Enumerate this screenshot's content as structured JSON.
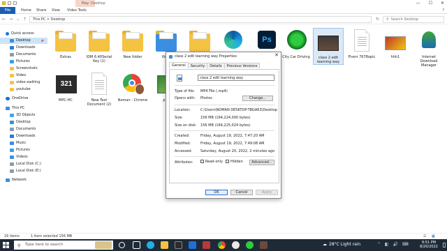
{
  "window": {
    "title": "Desktop",
    "context_tab": "Play",
    "controls": {
      "minimize": "—",
      "maximize": "☐",
      "close": "✕"
    }
  },
  "ribbon": {
    "tabs": [
      "File",
      "Home",
      "Share",
      "View",
      "Video Tools"
    ],
    "help": "?"
  },
  "address": {
    "path": "This PC  >  Desktop",
    "search_placeholder": "Search Desktop"
  },
  "sidebar": {
    "items": [
      {
        "label": "Quick access",
        "icon": "star-icon",
        "color": "#1a73e8"
      },
      {
        "label": "Desktop",
        "icon": "desktop-icon",
        "color": "#3a8fe0",
        "selected": true,
        "pinned": true
      },
      {
        "label": "Downloads",
        "icon": "download-icon",
        "color": "#2b7bd6",
        "pinned": true
      },
      {
        "label": "Documents",
        "icon": "documents-icon",
        "color": "#8a9bb0",
        "pinned": true
      },
      {
        "label": "Pictures",
        "icon": "pictures-icon",
        "color": "#3aa0e0",
        "pinned": true
      },
      {
        "label": "Screenshots",
        "icon": "folder-icon",
        "color": "#f5c342"
      },
      {
        "label": "Video",
        "icon": "folder-icon",
        "color": "#f5c342"
      },
      {
        "label": "video eadting",
        "icon": "folder-icon",
        "color": "#f5c342"
      },
      {
        "label": "youtube",
        "icon": "folder-icon",
        "color": "#f5c342"
      },
      {
        "label": "OneDrive",
        "icon": "cloud-icon",
        "color": "#1e6fd9"
      },
      {
        "label": "This PC",
        "icon": "pc-icon",
        "color": "#3a8fe0"
      },
      {
        "label": "3D Objects",
        "icon": "cube-icon",
        "color": "#4aa3df"
      },
      {
        "label": "Desktop",
        "icon": "desktop-icon",
        "color": "#3a8fe0"
      },
      {
        "label": "Documents",
        "icon": "documents-icon",
        "color": "#8a9bb0"
      },
      {
        "label": "Downloads",
        "icon": "download-icon",
        "color": "#2b7bd6"
      },
      {
        "label": "Music",
        "icon": "music-icon",
        "color": "#3a8fe0"
      },
      {
        "label": "Pictures",
        "icon": "pictures-icon",
        "color": "#3aa0e0"
      },
      {
        "label": "Videos",
        "icon": "videos-icon",
        "color": "#3a8fe0"
      },
      {
        "label": "Local Disk (C:)",
        "icon": "disk-icon",
        "color": "#8a9bb0"
      },
      {
        "label": "Local Disk (E:)",
        "icon": "disk-icon",
        "color": "#8a9bb0"
      },
      {
        "label": "Network",
        "icon": "network-icon",
        "color": "#3a8fe0"
      }
    ]
  },
  "files": [
    {
      "label": "Extras",
      "kind": "folder"
    },
    {
      "label": "IDM 6.40Serial Key (1)",
      "kind": "folder-zip"
    },
    {
      "label": "New folder",
      "kind": "folder"
    },
    {
      "label": "VidCl",
      "kind": "folder-blue"
    },
    {
      "label": "",
      "kind": "folder"
    },
    {
      "label": "",
      "kind": "edge"
    },
    {
      "label": "",
      "kind": "photoshop"
    },
    {
      "label": "City Car Driving",
      "kind": "game"
    },
    {
      "label": "class 2 edit learning way",
      "kind": "video",
      "selected": true
    },
    {
      "label": "Fiverr 7678opic",
      "kind": "doc"
    },
    {
      "label": "hhh1",
      "kind": "image"
    },
    {
      "label": "Internet Download Manager",
      "kind": "idm"
    },
    {
      "label": "MPC-HC",
      "kind": "mpc"
    },
    {
      "label": "New Text Document (2)",
      "kind": "doc"
    },
    {
      "label": "Noman - Chrome",
      "kind": "chrome"
    },
    {
      "label": "pho",
      "kind": "photo"
    }
  ],
  "dialog": {
    "title": "class 2 edit learning way Properties",
    "close": "✕",
    "tabs": [
      "General",
      "Security",
      "Details",
      "Previous Versions"
    ],
    "filename": "class 2 edit learning way",
    "rows": [
      {
        "label": "Type of file:",
        "value": "MP4 File (.mp4)"
      },
      {
        "label": "Opens with:",
        "value": "Photos"
      },
      {
        "label": "Location:",
        "value": "C:\\Users\\NOMAN DESKTOP-TBGA63\\Desktop"
      },
      {
        "label": "Size:",
        "value": "156 MB (164,224,000 bytes)"
      },
      {
        "label": "Size on disk:",
        "value": "156 MB (164,225,024 bytes)"
      },
      {
        "label": "Created:",
        "value": "Friday, August 19, 2022, 7:47:20 AM"
      },
      {
        "label": "Modified:",
        "value": "Friday, August 19, 2022, 7:49:08 AM"
      },
      {
        "label": "Accessed:",
        "value": "Saturday, August 20, 2022, 2 minutes ago"
      }
    ],
    "attributes_label": "Attributes:",
    "readonly_label": "Read-only",
    "hidden_label": "Hidden",
    "change_label": "Change...",
    "advanced_label": "Advanced...",
    "ok_label": "OK",
    "cancel_label": "Cancel",
    "apply_label": "Apply"
  },
  "status": {
    "items": "16 items",
    "selected": "1 item selected  156 MB"
  },
  "taskbar": {
    "search_placeholder": "Type here to search",
    "weather": "28°C  Light rain",
    "time": "9:51 PM",
    "date": "8/20/2022"
  }
}
